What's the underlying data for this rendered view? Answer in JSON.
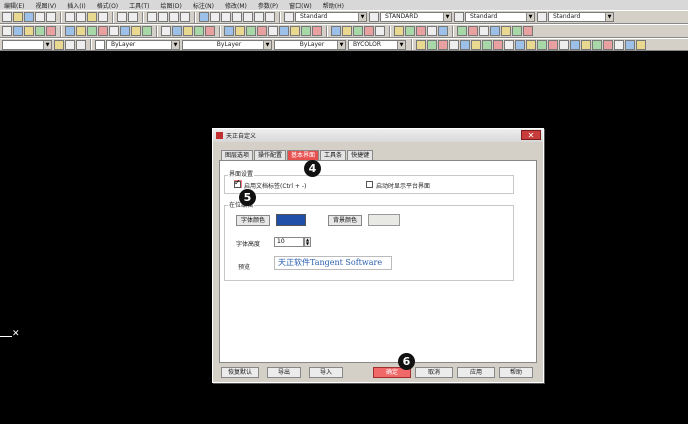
{
  "menu": [
    "编辑(E)",
    "视图(V)",
    "插入(I)",
    "格式(O)",
    "工具(T)",
    "绘图(D)",
    "标注(N)",
    "修改(M)",
    "参数(P)",
    "窗口(W)",
    "帮助(H)"
  ],
  "toolbar": {
    "text_style_value": "Standard",
    "dim_style_value": "STANDARD",
    "table_style_value": "Standard",
    "multileader_style_value": "Standard",
    "layer_color": "ByLayer",
    "layer_linetype": "ByLayer",
    "layer_lineweight": "ByLayer",
    "plot_style": "BYCOLOR"
  },
  "dialog": {
    "title": "天正自定义",
    "close_glyph": "✕",
    "tabs": [
      "图层选项",
      "操作配置",
      "基本界面",
      "工具条",
      "快捷键"
    ],
    "active_tab_index": 2,
    "group1_label": "界面设置",
    "enable_doc_tab_label": "启用文档标签(Ctrl + -)",
    "enable_doc_tab_checked": true,
    "enable_tangent_ui_label": "启动时显示平台界面",
    "enable_tangent_ui_checked": false,
    "group2_label": "在位编辑",
    "font_color_button": "字体颜色",
    "font_color": "#1f4fa8",
    "bg_color_button": "背景颜色",
    "bg_color": "#e8e8e4",
    "font_height_label": "字体高度",
    "font_height_value": "10",
    "preview_label": "预览",
    "preview_text": "天正软件Tangent Software",
    "buttons": {
      "restore_default": "恢复默认",
      "export": "导出",
      "import": "导入",
      "ok": "确定",
      "cancel": "取消",
      "apply": "应用",
      "help": "帮助"
    }
  },
  "markers": [
    "4",
    "5",
    "6"
  ]
}
